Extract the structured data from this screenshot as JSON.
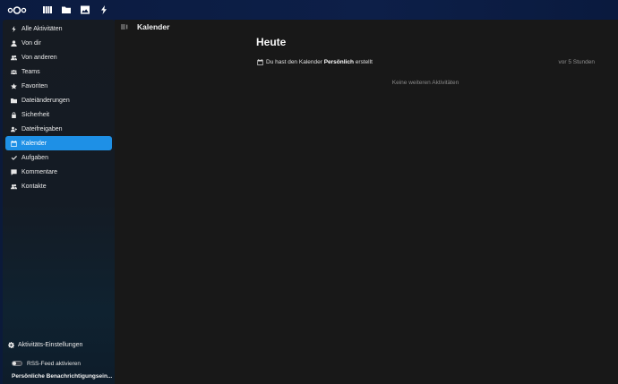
{
  "topbar": {
    "logo": "nextcloud-logo",
    "apps": [
      {
        "name": "dashboard",
        "icon": "dashboard-icon"
      },
      {
        "name": "files",
        "icon": "folder-icon"
      },
      {
        "name": "photos",
        "icon": "image-icon"
      },
      {
        "name": "activity",
        "icon": "lightning-icon"
      }
    ]
  },
  "sidebar": {
    "items": [
      {
        "label": "Alle Aktivitäten",
        "icon": "lightning-icon"
      },
      {
        "label": "Von dir",
        "icon": "user-icon"
      },
      {
        "label": "Von anderen",
        "icon": "users-icon"
      },
      {
        "label": "Teams",
        "icon": "teams-icon"
      },
      {
        "label": "Favoriten",
        "icon": "star-icon"
      },
      {
        "label": "Dateiänderungen",
        "icon": "folder-icon"
      },
      {
        "label": "Sicherheit",
        "icon": "lock-icon"
      },
      {
        "label": "Dateifreigaben",
        "icon": "share-icon"
      },
      {
        "label": "Kalender",
        "icon": "calendar-icon"
      },
      {
        "label": "Aufgaben",
        "icon": "check-icon"
      },
      {
        "label": "Kommentare",
        "icon": "comment-icon"
      },
      {
        "label": "Kontakte",
        "icon": "contacts-icon"
      }
    ],
    "active_index": 8,
    "settings_label": "Aktivitäts-Einstellungen",
    "rss_label": "RSS-Feed aktivieren",
    "notifications_label": "Persönliche Benachrichtigungsein..."
  },
  "main": {
    "title": "Kalender",
    "heading": "Heute",
    "activity": {
      "prefix": "Du hast den Kalender ",
      "calendar_name": "Persönlich",
      "suffix": " erstellt",
      "time": "vor 5 Stunden"
    },
    "empty_text": "Keine weiteren Aktivitäten"
  },
  "colors": {
    "accent": "#1e90e6",
    "background": "#181818",
    "header": "#0b1b40"
  }
}
